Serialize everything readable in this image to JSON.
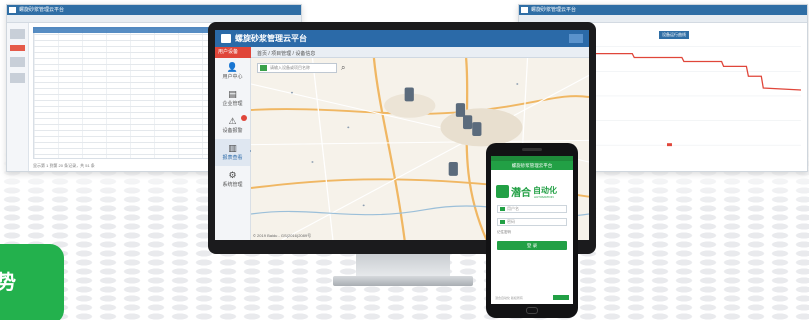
{
  "left_window": {
    "title": "螺旋砂浆管理云平台",
    "footer": "显示第 1 到第 20 条记录，共 51 条"
  },
  "right_window": {
    "title": "螺旋砂浆管理云平台",
    "chart_tag": "设备运行曲线"
  },
  "monitor": {
    "app_title": "螺旋砂浆管理云平台",
    "user_tab": "用户设备",
    "breadcrumb": "首页 / 项目管理 / 设备信息",
    "search_placeholder": "请输入设备或项目名称",
    "side_items": [
      {
        "label": "用户中心",
        "icon": "user-icon"
      },
      {
        "label": "企业管理",
        "icon": "building-icon"
      },
      {
        "label": "设备报警",
        "icon": "alarm-icon"
      },
      {
        "label": "报表查看",
        "icon": "report-icon"
      },
      {
        "label": "系统管理",
        "icon": "gear-icon"
      }
    ],
    "map_footer": "© 2019 Baidu - GS(2016)2089号"
  },
  "phone": {
    "title": "螺旋砂浆管理云平台",
    "logo_cn": "潜合",
    "logo_cn2": "自动化",
    "logo_en": "AUTOMATION",
    "username_placeholder": "用户名",
    "password_placeholder": "密码",
    "remember_label": "记住密码",
    "login_label": "登 录",
    "footer_text": "潜合自动化 版权所有"
  },
  "corner_badge": {
    "text": "势"
  },
  "colors": {
    "app_blue": "#2b6aa8",
    "alert_red": "#e0463a",
    "brand_green": "#22a045"
  }
}
